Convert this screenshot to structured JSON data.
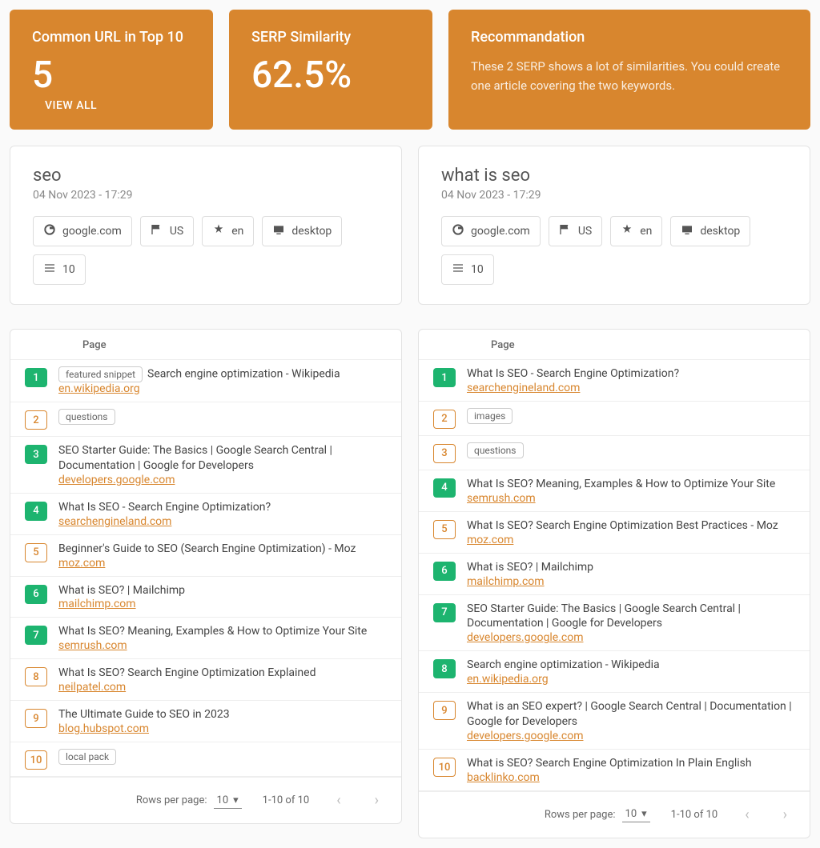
{
  "cards": {
    "common": {
      "title": "Common URL in Top 10",
      "value": "5",
      "action": "VIEW ALL"
    },
    "similarity": {
      "title": "SERP Similarity",
      "value": "62.5%"
    },
    "recommendation": {
      "title": "Recommandation",
      "text": "These 2 SERP shows a lot of similarities. You could create one article covering the two keywords."
    }
  },
  "panels": [
    {
      "keyword": "seo",
      "date": "04 Nov 2023 - 17:29",
      "chips": {
        "domain": "google.com",
        "country": "US",
        "lang": "en",
        "device": "desktop",
        "count": "10"
      }
    },
    {
      "keyword": "what is seo",
      "date": "04 Nov 2023 - 17:29",
      "chips": {
        "domain": "google.com",
        "country": "US",
        "lang": "en",
        "device": "desktop",
        "count": "10"
      }
    }
  ],
  "tables": [
    {
      "header": "Page",
      "rows": [
        {
          "rank": "1",
          "common": true,
          "tag": "featured snippet",
          "title": "Search engine optimization - Wikipedia",
          "domain": "en.wikipedia.org"
        },
        {
          "rank": "2",
          "common": false,
          "tag": "questions"
        },
        {
          "rank": "3",
          "common": true,
          "title": "SEO Starter Guide: The Basics | Google Search Central | Documentation | Google for Developers",
          "domain": "developers.google.com"
        },
        {
          "rank": "4",
          "common": true,
          "title": "What Is SEO - Search Engine Optimization?",
          "domain": "searchengineland.com"
        },
        {
          "rank": "5",
          "common": false,
          "title": "Beginner's Guide to SEO (Search Engine Optimization) - Moz",
          "domain": "moz.com"
        },
        {
          "rank": "6",
          "common": true,
          "title": "What is SEO? | Mailchimp",
          "domain": "mailchimp.com"
        },
        {
          "rank": "7",
          "common": true,
          "title": "What Is SEO? Meaning, Examples & How to Optimize Your Site",
          "domain": "semrush.com"
        },
        {
          "rank": "8",
          "common": false,
          "title": "What Is SEO? Search Engine Optimization Explained",
          "domain": "neilpatel.com"
        },
        {
          "rank": "9",
          "common": false,
          "title": "The Ultimate Guide to SEO in 2023",
          "domain": "blog.hubspot.com"
        },
        {
          "rank": "10",
          "common": false,
          "tag": "local pack"
        }
      ],
      "footer": {
        "label": "Rows per page:",
        "perpage": "10",
        "range": "1-10 of 10"
      }
    },
    {
      "header": "Page",
      "rows": [
        {
          "rank": "1",
          "common": true,
          "title": "What Is SEO - Search Engine Optimization?",
          "domain": "searchengineland.com"
        },
        {
          "rank": "2",
          "common": false,
          "tag": "images"
        },
        {
          "rank": "3",
          "common": false,
          "tag": "questions"
        },
        {
          "rank": "4",
          "common": true,
          "title": "What Is SEO? Meaning, Examples & How to Optimize Your Site",
          "domain": "semrush.com"
        },
        {
          "rank": "5",
          "common": false,
          "title": "What Is SEO? Search Engine Optimization Best Practices - Moz",
          "domain": "moz.com"
        },
        {
          "rank": "6",
          "common": true,
          "title": "What is SEO? | Mailchimp",
          "domain": "mailchimp.com"
        },
        {
          "rank": "7",
          "common": true,
          "title": "SEO Starter Guide: The Basics | Google Search Central | Documentation | Google for Developers",
          "domain": "developers.google.com"
        },
        {
          "rank": "8",
          "common": true,
          "title": "Search engine optimization - Wikipedia",
          "domain": "en.wikipedia.org"
        },
        {
          "rank": "9",
          "common": false,
          "title": "What is an SEO expert? | Google Search Central | Documentation | Google for Developers",
          "domain": "developers.google.com"
        },
        {
          "rank": "10",
          "common": false,
          "title": "What is SEO? Search Engine Optimization In Plain English",
          "domain": "backlinko.com"
        }
      ],
      "footer": {
        "label": "Rows per page:",
        "perpage": "10",
        "range": "1-10 of 10"
      }
    }
  ]
}
